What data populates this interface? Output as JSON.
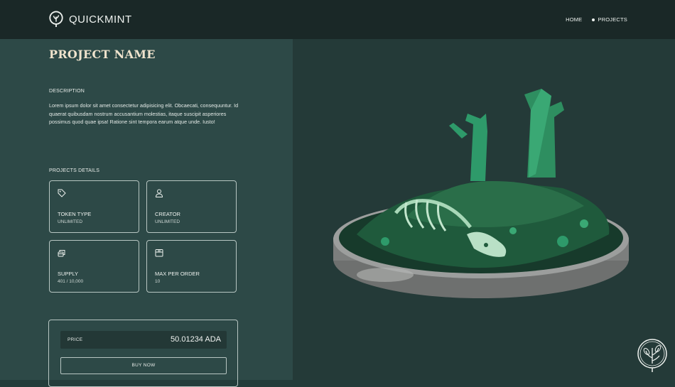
{
  "header": {
    "brand": "QUICKMINT",
    "nav": [
      {
        "label": "HOME"
      },
      {
        "label": "PROJECTS"
      }
    ]
  },
  "project": {
    "title": "PROJECT NAME",
    "description_label": "DESCRIPTION",
    "description": "Lorem ipsum dolor sit amet consectetur adipisicing elit. Obcaecati, consequuntur. Id quaerat quibusdam nostrum accusantium molestias, itaque suscipit asperiores possimus quod quae ipsa! Ratione sint tempora earum atque unde. Iusto!",
    "details_label": "PROJECTS DETAILS",
    "details": [
      {
        "icon": "tag-icon",
        "label": "TOKEN TYPE",
        "value": "UNLIMITED"
      },
      {
        "icon": "user-icon",
        "label": "CREATOR",
        "value": "UNLIMITED"
      },
      {
        "icon": "coins-icon",
        "label": "SUPPLY",
        "value": "401 / 10,000"
      },
      {
        "icon": "box-icon",
        "label": "MAX PER ORDER",
        "value": "10"
      }
    ]
  },
  "purchase": {
    "price_label": "PRICE",
    "price_value": "50.01234 ADA",
    "buy_label": "BUY NOW"
  },
  "colors": {
    "header_bg": "#1a2827",
    "left_panel_bg": "#2d4947",
    "right_panel_bg": "#243a38",
    "title_color": "#efe3cd",
    "accent_green": "#2e9a6a"
  }
}
